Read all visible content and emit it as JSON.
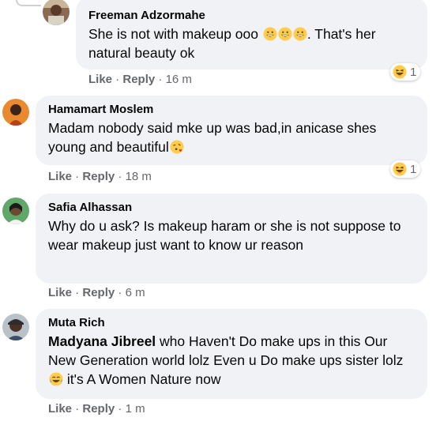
{
  "comments": [
    {
      "author": "Freeman Adzormahe",
      "text_before": "She is not with makeup ooo ",
      "emojis": "grinning-face-emoji x3",
      "text_after": ". That's her natural beauty ok",
      "actions": {
        "like": "Like",
        "reply": "Reply",
        "time": "16 m"
      },
      "reaction": {
        "icon": "laughing-emoji",
        "count": "1"
      }
    },
    {
      "author": "Hamamart Moslem",
      "text": "Madam nobody said mke up was bad,in anicase shes young and beautiful",
      "emoji": "face-blowing-kiss-emoji",
      "actions": {
        "like": "Like",
        "reply": "Reply",
        "time": "18 m"
      },
      "reaction": {
        "icon": "laughing-emoji",
        "count": "1"
      }
    },
    {
      "author": "Safia Alhassan",
      "text": "Why do u ask? Is makeup haram or she is not suppose to wear makeup just want to know ur reason",
      "actions": {
        "like": "Like",
        "reply": "Reply",
        "time": "6 m"
      }
    },
    {
      "author": "Muta Rich",
      "mention": "Madyana Jibreel",
      "text_before": " who Haven't Do make ups in this Our New Generation world lolz Even u Do make ups sister lolz ",
      "emoji": "tears-of-joy-emoji",
      "text_after": " it's A Women Nature now",
      "actions": {
        "like": "Like",
        "reply": "Reply",
        "time": "1 m"
      }
    }
  ],
  "colors": {
    "bubble": "#f0f2f5",
    "meta_text": "#65676b",
    "emoji_yellow": "#ffcc4d"
  }
}
